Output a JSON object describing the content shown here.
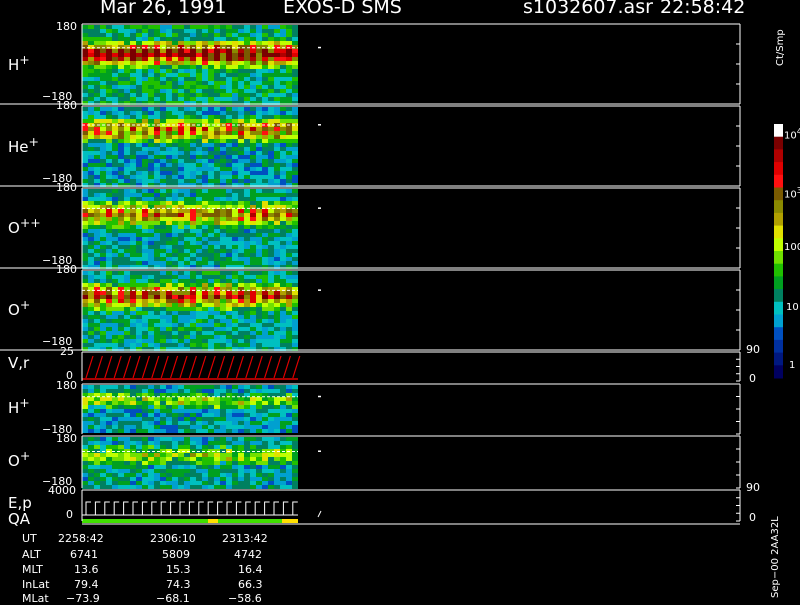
{
  "header": {
    "date": "Mar 26, 1991",
    "instrument": "EXOS-D SMS",
    "filename": "s1032607.asr",
    "time": "22:58:42"
  },
  "panels": [
    {
      "label": "H",
      "sup": "+",
      "y_top": "180",
      "y_bottom": "−180"
    },
    {
      "label": "He",
      "sup": "+",
      "y_top": "180",
      "y_bottom": "−180"
    },
    {
      "label": "O",
      "sup": "++",
      "y_top": "180",
      "y_bottom": "−180"
    },
    {
      "label": "O",
      "sup": "+",
      "y_top": "180",
      "y_bottom": "−180"
    },
    {
      "label": "V,r",
      "sup": "",
      "y_top": "25",
      "y_bottom": "0",
      "right_top": "90",
      "right_bottom": "0"
    },
    {
      "label": "H",
      "sup": "+",
      "y_top": "180",
      "y_bottom": "−180"
    },
    {
      "label": "O",
      "sup": "+",
      "y_top": "180",
      "y_bottom": "−180"
    },
    {
      "label": "E,p",
      "sup": "",
      "y_top": "4000",
      "y_bottom": "0",
      "right_top": "90",
      "right_bottom": "0"
    }
  ],
  "qa_label": "QA",
  "colorbar": {
    "unit": "Ct/Smp",
    "labels": [
      "10^4",
      "10^3",
      "100",
      "10",
      "1"
    ],
    "colors": [
      "#ffffff",
      "#7a0000",
      "#b00000",
      "#e00000",
      "#ff1010",
      "#7a5a00",
      "#8a8a00",
      "#b0a000",
      "#e0e000",
      "#c0ff00",
      "#70e000",
      "#20c000",
      "#00a020",
      "#008060",
      "#00c0c0",
      "#00a0d0",
      "#0050c0",
      "#0030a0",
      "#001880",
      "#000060"
    ]
  },
  "footer": {
    "rows": [
      {
        "name": "UT",
        "values": [
          "2258:42",
          "2306:10",
          "2313:42"
        ]
      },
      {
        "name": "ALT",
        "values": [
          "6741",
          "5809",
          "4742"
        ]
      },
      {
        "name": "MLT",
        "values": [
          "13.6",
          "15.3",
          "16.4"
        ]
      },
      {
        "name": "InLat",
        "values": [
          "79.4",
          "74.3",
          "66.3"
        ]
      },
      {
        "name": "MLat",
        "values": [
          "−73.9",
          "−68.1",
          "−58.6"
        ]
      }
    ],
    "side_note": "Sep−00 2AA32L"
  },
  "chart_data": {
    "type": "heatmap",
    "title": "Mar 26, 1991   EXOS-D SMS",
    "panels": [
      {
        "name": "H+",
        "ylim": [
          -180,
          180
        ]
      },
      {
        "name": "He+",
        "ylim": [
          -180,
          180
        ]
      },
      {
        "name": "O++",
        "ylim": [
          -180,
          180
        ]
      },
      {
        "name": "O+",
        "ylim": [
          -180,
          180
        ]
      },
      {
        "name": "V,r",
        "ylim": [
          0,
          25
        ],
        "right_ylim": [
          0,
          90
        ]
      },
      {
        "name": "H+",
        "ylim": [
          -180,
          180
        ]
      },
      {
        "name": "O+",
        "ylim": [
          -180,
          180
        ]
      },
      {
        "name": "E,p",
        "ylim": [
          0,
          4000
        ],
        "right_ylim": [
          0,
          90
        ]
      }
    ],
    "x_ticks": [
      "2258:42",
      "2306:10",
      "2313:42"
    ],
    "colorbar_scale": "log",
    "colorbar_range": [
      1,
      10000
    ],
    "colorbar_unit": "Ct/Smp",
    "data_coverage_fraction": 0.3
  }
}
